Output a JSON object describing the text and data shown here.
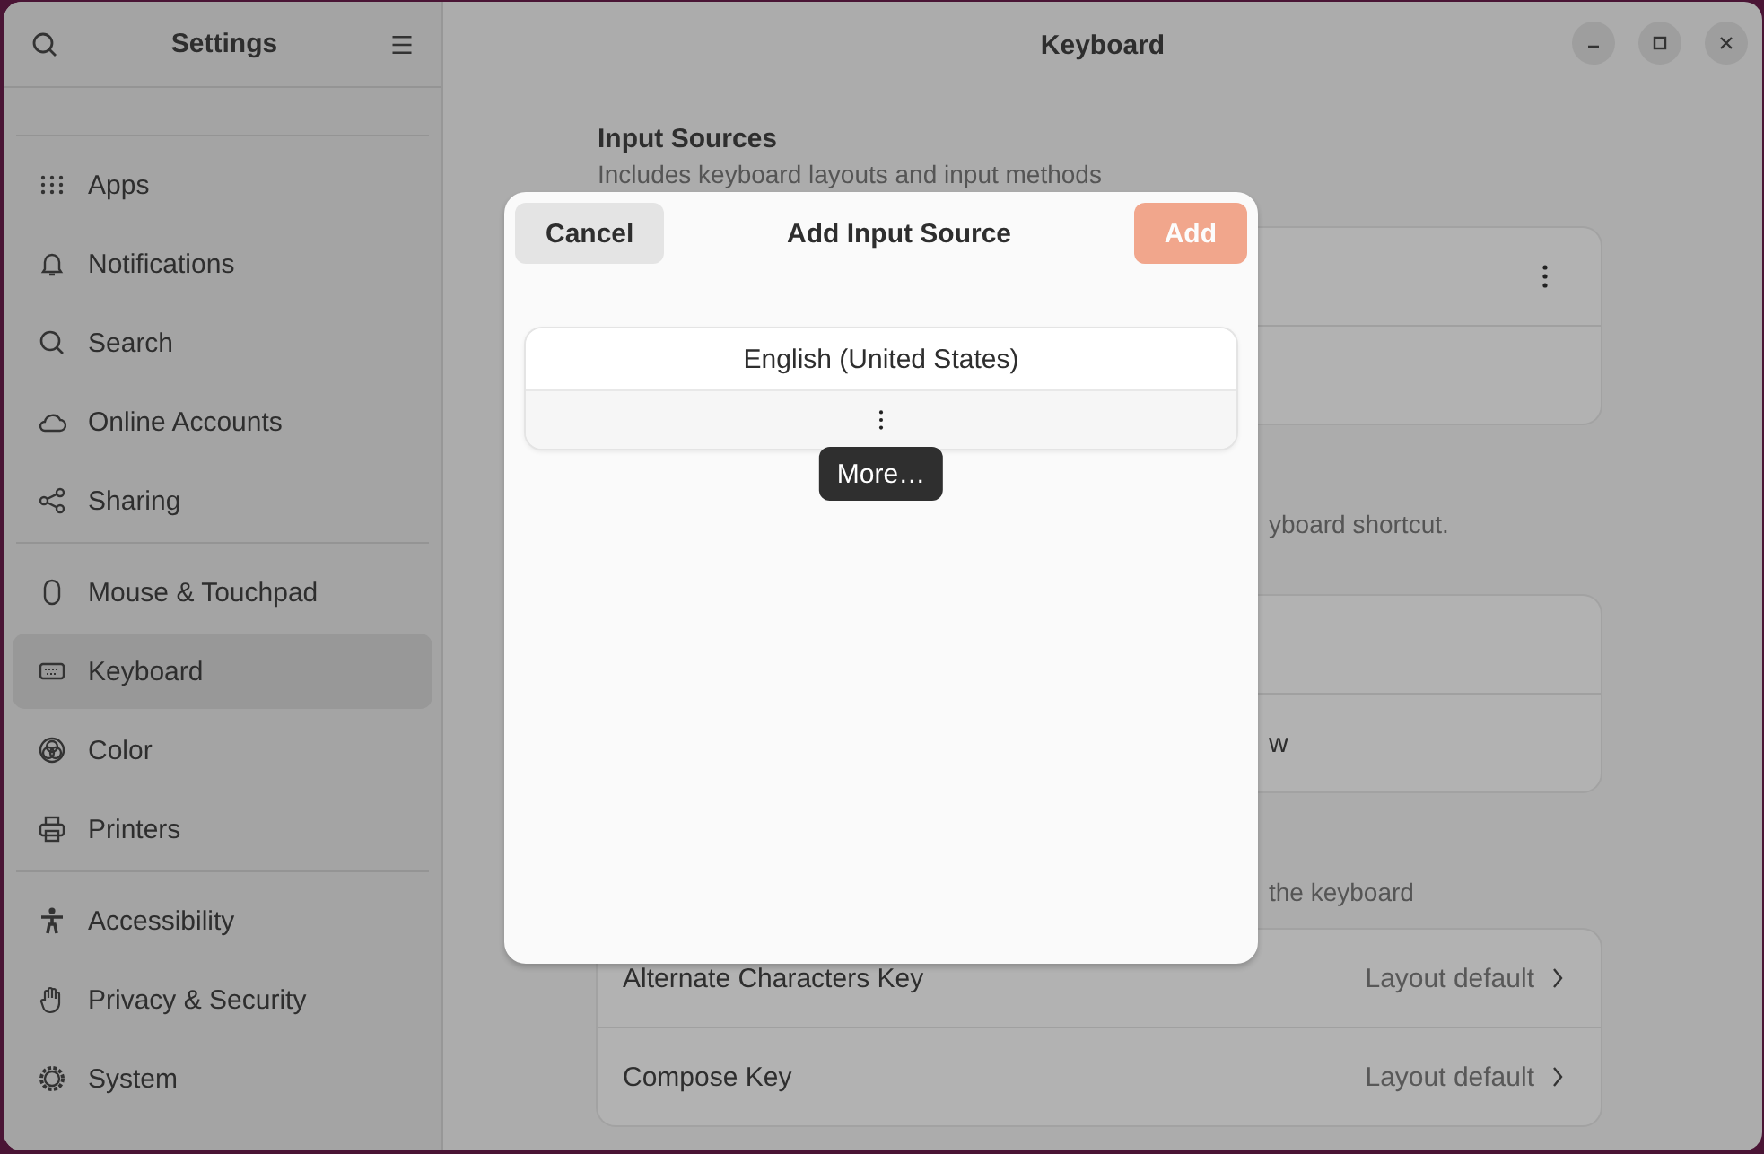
{
  "sidebar": {
    "title": "Settings",
    "groups": [
      [
        {
          "label": "Apps",
          "selected": false
        },
        {
          "label": "Notifications",
          "selected": false
        },
        {
          "label": "Search",
          "selected": false
        },
        {
          "label": "Online Accounts",
          "selected": false
        },
        {
          "label": "Sharing",
          "selected": false
        }
      ],
      [
        {
          "label": "Mouse & Touchpad",
          "selected": false
        },
        {
          "label": "Keyboard",
          "selected": true
        },
        {
          "label": "Color",
          "selected": false
        },
        {
          "label": "Printers",
          "selected": false
        }
      ],
      [
        {
          "label": "Accessibility",
          "selected": false
        },
        {
          "label": "Privacy & Security",
          "selected": false
        },
        {
          "label": "System",
          "selected": false
        }
      ]
    ]
  },
  "window": {
    "title": "Keyboard"
  },
  "input_sources": {
    "title": "Input Sources",
    "subtitle": "Includes keyboard layouts and input methods"
  },
  "section_2": {
    "subtitle_fragment": "yboard shortcut.",
    "row_2_fragment": "w"
  },
  "section_3": {
    "subtitle_fragment": "the keyboard",
    "rows": [
      {
        "label": "Alternate Characters Key",
        "value": "Layout default"
      },
      {
        "label": "Compose Key",
        "value": "Layout default"
      }
    ]
  },
  "dialog": {
    "title": "Add Input Source",
    "cancel": "Cancel",
    "add": {
      "label": "Add",
      "disabled": true
    },
    "languages": [
      "English (United States)"
    ],
    "tooltip": "More…"
  }
}
